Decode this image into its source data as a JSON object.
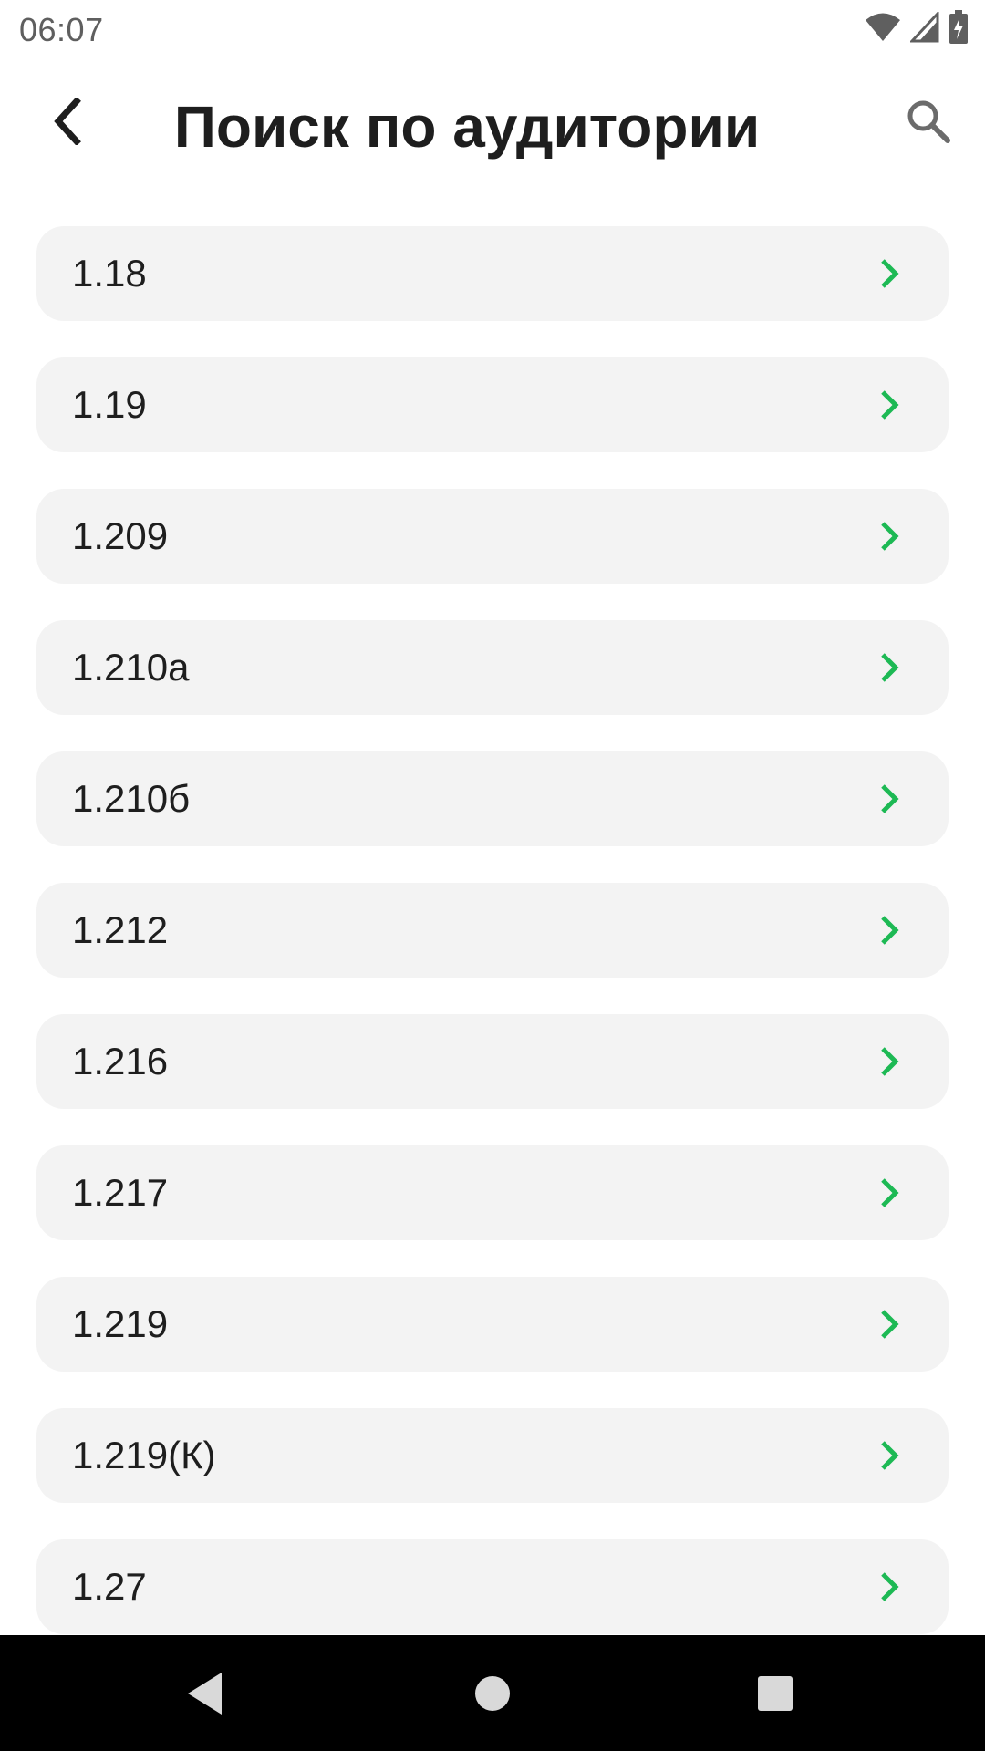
{
  "status_bar": {
    "time": "06:07",
    "icons": [
      "wifi-icon",
      "cell-signal-icon",
      "battery-charging-icon"
    ]
  },
  "app_bar": {
    "back_icon": "chevron-left-icon",
    "title": "Поиск по аудитории",
    "search_icon": "search-icon"
  },
  "accent_color": "#1db954",
  "rooms": [
    {
      "label": "1.18"
    },
    {
      "label": "1.19"
    },
    {
      "label": "1.209"
    },
    {
      "label": "1.210а"
    },
    {
      "label": "1.210б"
    },
    {
      "label": "1.212"
    },
    {
      "label": "1.216"
    },
    {
      "label": "1.217"
    },
    {
      "label": "1.219"
    },
    {
      "label": "1.219(К)"
    },
    {
      "label": "1.27"
    }
  ],
  "nav_bar": {
    "buttons": [
      "back-triangle-icon",
      "home-circle-icon",
      "recents-square-icon"
    ]
  }
}
